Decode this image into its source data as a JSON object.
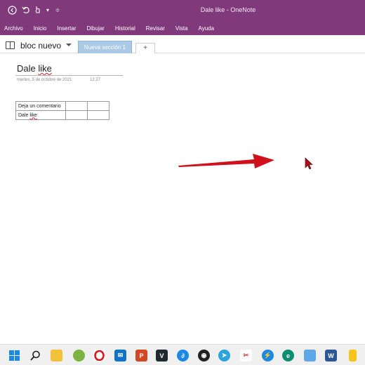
{
  "window": {
    "title": "Dale like  -  OneNote"
  },
  "menu": [
    "Archivo",
    "Inicio",
    "Insertar",
    "Dibujar",
    "Historial",
    "Revisar",
    "Vista",
    "Ayuda"
  ],
  "notebook": {
    "name": "bloc nuevo",
    "section_tab": "Nueva sección 1",
    "add_tab": "+"
  },
  "page": {
    "title_main": "Dale ",
    "title_like": "like",
    "date": "martes, 5 de octubre de 2021",
    "time": "12:27",
    "table": {
      "r1c1": "Deja un comentario",
      "r2c1_main": "Dale ",
      "r2c1_like": "like"
    }
  },
  "taskbar_icons": [
    "windows-icon",
    "search-icon",
    "file-explorer-icon",
    "app-icon",
    "opera-icon",
    "mail-icon",
    "powerpoint-icon",
    "vectr-icon",
    "app-icon",
    "obs-icon",
    "telegram-icon",
    "snipping-tool-icon",
    "app-icon",
    "edge-icon",
    "photos-icon",
    "word-icon",
    "notes-icon"
  ],
  "colors": {
    "onenote_purple": "#80397b",
    "active_tab": "#a9c9e6",
    "arrow_red": "#d0101a"
  }
}
